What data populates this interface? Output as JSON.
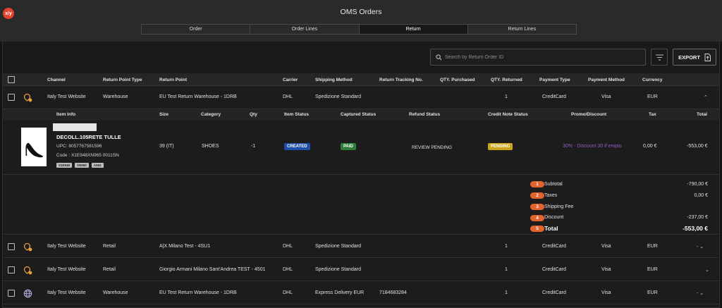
{
  "app": {
    "logo_text": "x/y",
    "title": "OMS Orders",
    "tabs": [
      "Order",
      "Order Lines",
      "Return",
      "Return Lines"
    ],
    "active_tab": "Return"
  },
  "toolbar": {
    "search_placeholder": "Search by Return Order ID",
    "export_label": "EXPORT"
  },
  "columns": {
    "channel": "Channel",
    "return_point_type": "Return Point Type",
    "return_point": "Return Point",
    "carrier": "Carrier",
    "shipping_method": "Shipping Method",
    "return_tracking": "Return Tracking No.",
    "qty_purchased": "QTY. Purchased",
    "qty_returned": "QTY. Returned",
    "payment_type": "Payment Type",
    "payment_method": "Payment Method",
    "currency": "Currency"
  },
  "rows": [
    {
      "channel": "Italy Test Website",
      "return_point_type": "Warehouse",
      "return_point": "EU Test Return Warehouse - 1DRB",
      "carrier": "DHL",
      "shipping_method": "Spedizione Standard",
      "tracking": "",
      "qty_returned": "1",
      "payment_type": "CreditCard",
      "payment_method": "Visa",
      "currency": "EUR",
      "expand": "⌃"
    },
    {
      "channel": "Italy Test Website",
      "return_point_type": "Retail",
      "return_point": "A|X Milano Test - 4SU1",
      "carrier": "DHL",
      "shipping_method": "Spedizione Standard",
      "tracking": "",
      "qty_returned": "1",
      "payment_type": "CreditCard",
      "payment_method": "Visa",
      "currency": "EUR",
      "expand": "- ⌄"
    },
    {
      "channel": "Italy Test Website",
      "return_point_type": "Retail",
      "return_point": "Giorgio Armani Milano Sant'Andrea TEST - 4501",
      "carrier": "DHL",
      "shipping_method": "Spedizione Standard",
      "tracking": "",
      "qty_returned": "1",
      "payment_type": "CreditCard",
      "payment_method": "Visa",
      "currency": "EUR",
      "expand": "⌄"
    },
    {
      "channel": "Italy Test Website",
      "return_point_type": "Warehouse",
      "return_point": "EU Test Return Warehouse - 1DRB",
      "carrier": "DHL",
      "shipping_method": "Express Delivery EUR",
      "tracking": "7184683284",
      "qty_returned": "1",
      "payment_type": "CreditCard",
      "payment_method": "Visa",
      "currency": "EUR",
      "expand": "- ⌄"
    }
  ],
  "sub_columns": {
    "item_info": "Item Info",
    "size": "Size",
    "category": "Category",
    "qty": "Qty",
    "item_status": "Item Status",
    "captured_status": "Captured Status",
    "refund_status": "Refund Status",
    "credit_note_status": "Credit Note Status",
    "promo": "Promo/Discount",
    "tax": "Tax",
    "total": "Total"
  },
  "item": {
    "name": "DECOLL.105RETE TULLE",
    "upc": "UPC: 8057767581596",
    "code": "Code : X1E948XN965 0011SN",
    "tags": [
      "X1E948",
      "XN965",
      "A083"
    ],
    "size": "39 (IT)",
    "category": "SHOES",
    "qty": "-1",
    "item_status": "CREATED",
    "captured_status": "PAID",
    "refund_status": "REVIEW PENDING",
    "credit_note_status": "PENDING",
    "promo": "30% - Discount 30 if empio",
    "tax": "0,00 €",
    "total": "-553,00 €"
  },
  "totals": [
    {
      "num": "1",
      "label": "Subtotal",
      "value": "-790,00 €"
    },
    {
      "num": "2",
      "label": "Taxes",
      "value": "0,00 €"
    },
    {
      "num": "3",
      "label": "Shipping Fee",
      "value": ""
    },
    {
      "num": "4",
      "label": "Discount",
      "value": "-237,00 €"
    },
    {
      "num": "5",
      "label": "Total",
      "value": "-553,00 €"
    }
  ],
  "colors": {
    "accent_orange": "#e2642d",
    "created_blue": "#1f4fa8",
    "paid_green": "#2f7d3a",
    "pending_yellow": "#c9a51b",
    "promo_purple": "#9b59c7",
    "icon_orange": "#e8a13a"
  }
}
